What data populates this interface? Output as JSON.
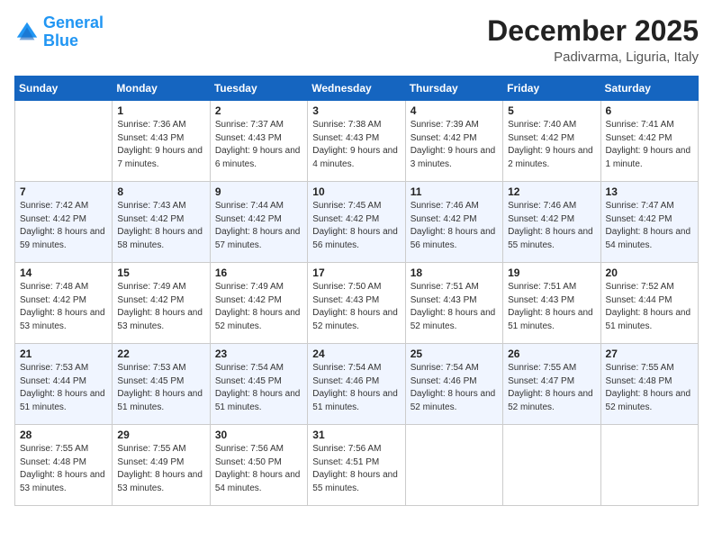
{
  "header": {
    "logo_line1": "General",
    "logo_line2": "Blue",
    "month": "December 2025",
    "location": "Padivarma, Liguria, Italy"
  },
  "days_of_week": [
    "Sunday",
    "Monday",
    "Tuesday",
    "Wednesday",
    "Thursday",
    "Friday",
    "Saturday"
  ],
  "weeks": [
    [
      {
        "day": "",
        "sunrise": "",
        "sunset": "",
        "daylight": ""
      },
      {
        "day": "1",
        "sunrise": "Sunrise: 7:36 AM",
        "sunset": "Sunset: 4:43 PM",
        "daylight": "Daylight: 9 hours and 7 minutes."
      },
      {
        "day": "2",
        "sunrise": "Sunrise: 7:37 AM",
        "sunset": "Sunset: 4:43 PM",
        "daylight": "Daylight: 9 hours and 6 minutes."
      },
      {
        "day": "3",
        "sunrise": "Sunrise: 7:38 AM",
        "sunset": "Sunset: 4:43 PM",
        "daylight": "Daylight: 9 hours and 4 minutes."
      },
      {
        "day": "4",
        "sunrise": "Sunrise: 7:39 AM",
        "sunset": "Sunset: 4:42 PM",
        "daylight": "Daylight: 9 hours and 3 minutes."
      },
      {
        "day": "5",
        "sunrise": "Sunrise: 7:40 AM",
        "sunset": "Sunset: 4:42 PM",
        "daylight": "Daylight: 9 hours and 2 minutes."
      },
      {
        "day": "6",
        "sunrise": "Sunrise: 7:41 AM",
        "sunset": "Sunset: 4:42 PM",
        "daylight": "Daylight: 9 hours and 1 minute."
      }
    ],
    [
      {
        "day": "7",
        "sunrise": "Sunrise: 7:42 AM",
        "sunset": "Sunset: 4:42 PM",
        "daylight": "Daylight: 8 hours and 59 minutes."
      },
      {
        "day": "8",
        "sunrise": "Sunrise: 7:43 AM",
        "sunset": "Sunset: 4:42 PM",
        "daylight": "Daylight: 8 hours and 58 minutes."
      },
      {
        "day": "9",
        "sunrise": "Sunrise: 7:44 AM",
        "sunset": "Sunset: 4:42 PM",
        "daylight": "Daylight: 8 hours and 57 minutes."
      },
      {
        "day": "10",
        "sunrise": "Sunrise: 7:45 AM",
        "sunset": "Sunset: 4:42 PM",
        "daylight": "Daylight: 8 hours and 56 minutes."
      },
      {
        "day": "11",
        "sunrise": "Sunrise: 7:46 AM",
        "sunset": "Sunset: 4:42 PM",
        "daylight": "Daylight: 8 hours and 56 minutes."
      },
      {
        "day": "12",
        "sunrise": "Sunrise: 7:46 AM",
        "sunset": "Sunset: 4:42 PM",
        "daylight": "Daylight: 8 hours and 55 minutes."
      },
      {
        "day": "13",
        "sunrise": "Sunrise: 7:47 AM",
        "sunset": "Sunset: 4:42 PM",
        "daylight": "Daylight: 8 hours and 54 minutes."
      }
    ],
    [
      {
        "day": "14",
        "sunrise": "Sunrise: 7:48 AM",
        "sunset": "Sunset: 4:42 PM",
        "daylight": "Daylight: 8 hours and 53 minutes."
      },
      {
        "day": "15",
        "sunrise": "Sunrise: 7:49 AM",
        "sunset": "Sunset: 4:42 PM",
        "daylight": "Daylight: 8 hours and 53 minutes."
      },
      {
        "day": "16",
        "sunrise": "Sunrise: 7:49 AM",
        "sunset": "Sunset: 4:42 PM",
        "daylight": "Daylight: 8 hours and 52 minutes."
      },
      {
        "day": "17",
        "sunrise": "Sunrise: 7:50 AM",
        "sunset": "Sunset: 4:43 PM",
        "daylight": "Daylight: 8 hours and 52 minutes."
      },
      {
        "day": "18",
        "sunrise": "Sunrise: 7:51 AM",
        "sunset": "Sunset: 4:43 PM",
        "daylight": "Daylight: 8 hours and 52 minutes."
      },
      {
        "day": "19",
        "sunrise": "Sunrise: 7:51 AM",
        "sunset": "Sunset: 4:43 PM",
        "daylight": "Daylight: 8 hours and 51 minutes."
      },
      {
        "day": "20",
        "sunrise": "Sunrise: 7:52 AM",
        "sunset": "Sunset: 4:44 PM",
        "daylight": "Daylight: 8 hours and 51 minutes."
      }
    ],
    [
      {
        "day": "21",
        "sunrise": "Sunrise: 7:53 AM",
        "sunset": "Sunset: 4:44 PM",
        "daylight": "Daylight: 8 hours and 51 minutes."
      },
      {
        "day": "22",
        "sunrise": "Sunrise: 7:53 AM",
        "sunset": "Sunset: 4:45 PM",
        "daylight": "Daylight: 8 hours and 51 minutes."
      },
      {
        "day": "23",
        "sunrise": "Sunrise: 7:54 AM",
        "sunset": "Sunset: 4:45 PM",
        "daylight": "Daylight: 8 hours and 51 minutes."
      },
      {
        "day": "24",
        "sunrise": "Sunrise: 7:54 AM",
        "sunset": "Sunset: 4:46 PM",
        "daylight": "Daylight: 8 hours and 51 minutes."
      },
      {
        "day": "25",
        "sunrise": "Sunrise: 7:54 AM",
        "sunset": "Sunset: 4:46 PM",
        "daylight": "Daylight: 8 hours and 52 minutes."
      },
      {
        "day": "26",
        "sunrise": "Sunrise: 7:55 AM",
        "sunset": "Sunset: 4:47 PM",
        "daylight": "Daylight: 8 hours and 52 minutes."
      },
      {
        "day": "27",
        "sunrise": "Sunrise: 7:55 AM",
        "sunset": "Sunset: 4:48 PM",
        "daylight": "Daylight: 8 hours and 52 minutes."
      }
    ],
    [
      {
        "day": "28",
        "sunrise": "Sunrise: 7:55 AM",
        "sunset": "Sunset: 4:48 PM",
        "daylight": "Daylight: 8 hours and 53 minutes."
      },
      {
        "day": "29",
        "sunrise": "Sunrise: 7:55 AM",
        "sunset": "Sunset: 4:49 PM",
        "daylight": "Daylight: 8 hours and 53 minutes."
      },
      {
        "day": "30",
        "sunrise": "Sunrise: 7:56 AM",
        "sunset": "Sunset: 4:50 PM",
        "daylight": "Daylight: 8 hours and 54 minutes."
      },
      {
        "day": "31",
        "sunrise": "Sunrise: 7:56 AM",
        "sunset": "Sunset: 4:51 PM",
        "daylight": "Daylight: 8 hours and 55 minutes."
      },
      {
        "day": "",
        "sunrise": "",
        "sunset": "",
        "daylight": ""
      },
      {
        "day": "",
        "sunrise": "",
        "sunset": "",
        "daylight": ""
      },
      {
        "day": "",
        "sunrise": "",
        "sunset": "",
        "daylight": ""
      }
    ]
  ]
}
